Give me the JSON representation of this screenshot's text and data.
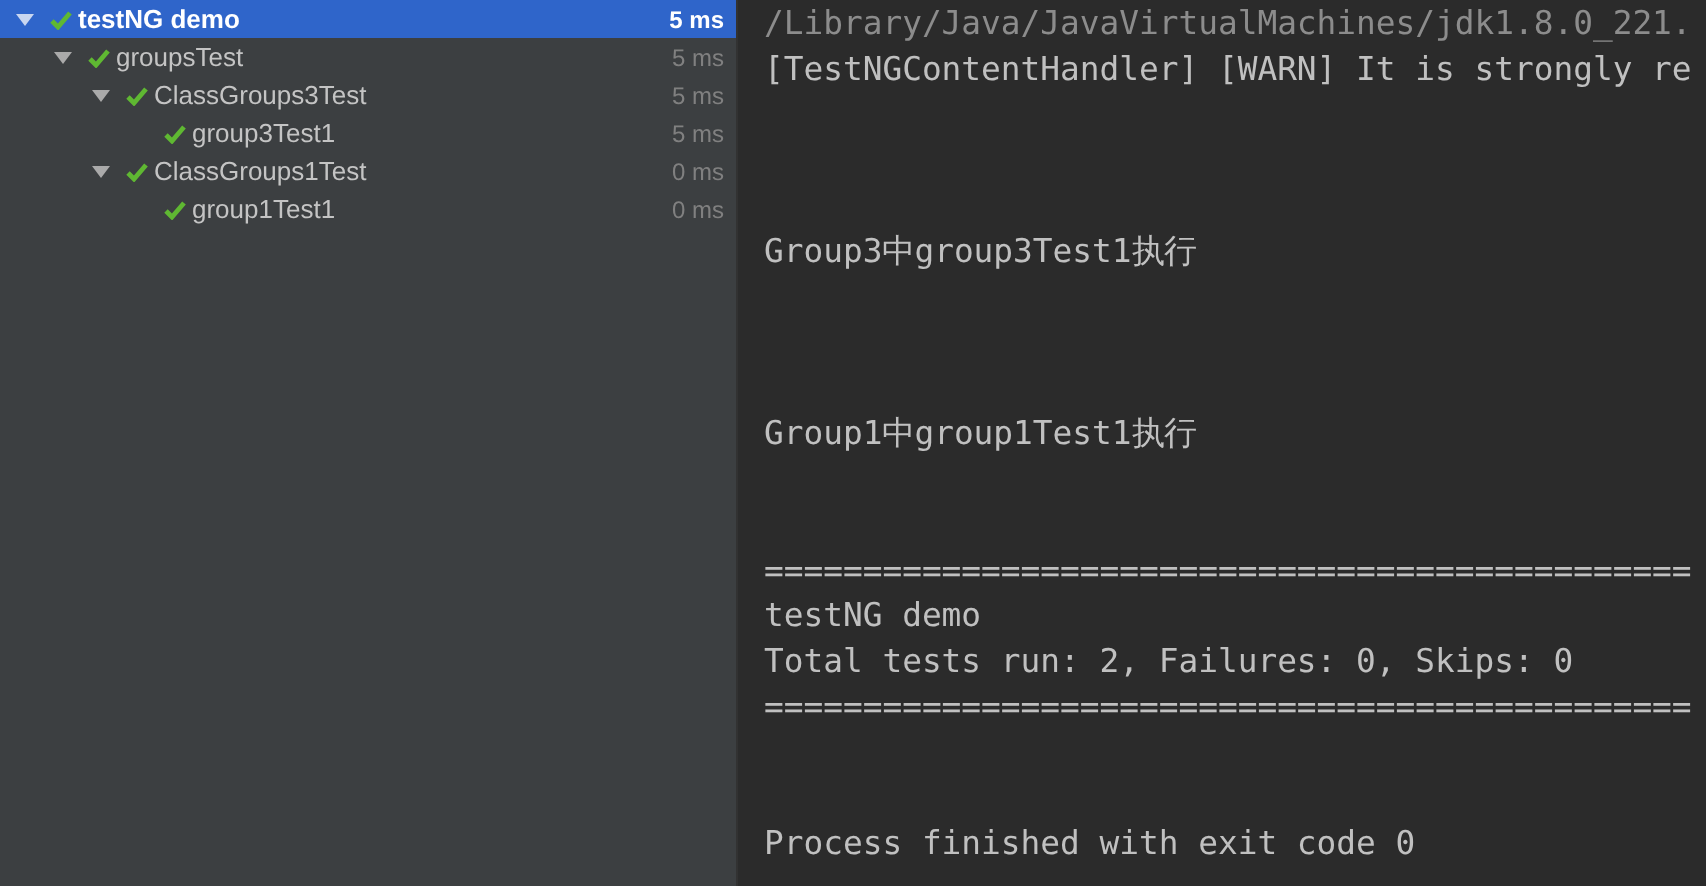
{
  "test_tree": [
    {
      "label": "testNG demo",
      "time": "5 ms",
      "selected": true,
      "expanded": true,
      "passed": true,
      "children": [
        {
          "label": "groupsTest",
          "time": "5 ms",
          "selected": false,
          "expanded": true,
          "passed": true,
          "children": [
            {
              "label": "ClassGroups3Test",
              "time": "5 ms",
              "selected": false,
              "expanded": true,
              "passed": true,
              "children": [
                {
                  "label": "group3Test1",
                  "time": "5 ms",
                  "selected": false,
                  "passed": true
                }
              ]
            },
            {
              "label": "ClassGroups1Test",
              "time": "0 ms",
              "selected": false,
              "expanded": true,
              "passed": true,
              "children": [
                {
                  "label": "group1Test1",
                  "time": "0 ms",
                  "selected": false,
                  "passed": true
                }
              ]
            }
          ]
        }
      ]
    }
  ],
  "console": {
    "blocks": [
      {
        "lines": [
          {
            "text": "/Library/Java/JavaVirtualMachines/jdk1.8.0_221.",
            "kind": "command"
          },
          {
            "text": "[TestNGContentHandler] [WARN] It is strongly re",
            "kind": "output"
          }
        ]
      },
      {
        "lines": [
          {
            "text": "Group3中group3Test1执行",
            "kind": "output"
          }
        ]
      },
      {
        "lines": [
          {
            "text": "Group1中group1Test1执行",
            "kind": "output"
          }
        ]
      },
      {
        "lines": [
          {
            "text": "===============================================",
            "kind": "output"
          },
          {
            "text": "testNG demo",
            "kind": "output"
          },
          {
            "text": "Total tests run: 2, Failures: 0, Skips: 0",
            "kind": "output"
          },
          {
            "text": "===============================================",
            "kind": "output"
          }
        ]
      },
      {
        "lines": [
          {
            "text": "Process finished with exit code 0",
            "kind": "output"
          }
        ]
      }
    ]
  }
}
